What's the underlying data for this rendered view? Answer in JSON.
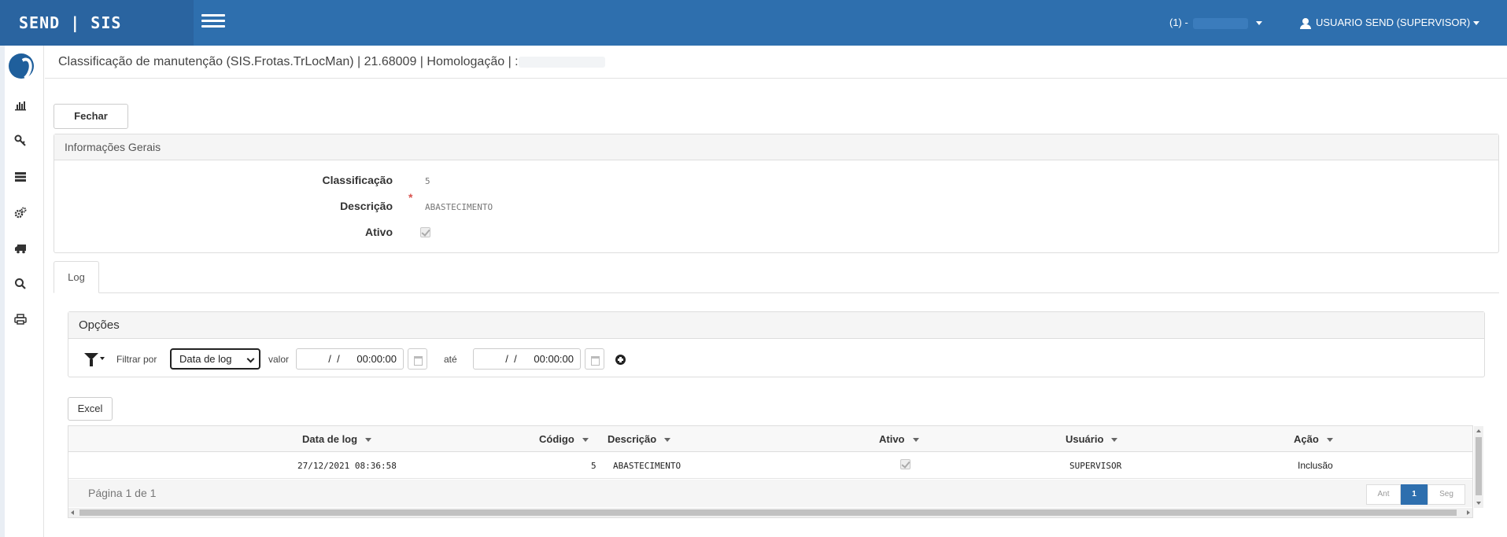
{
  "app": {
    "brand": "SEND | SIS",
    "company_prefix": "(1) -",
    "user": "USUARIO SEND (SUPERVISOR)"
  },
  "colors": {
    "topbar": "#2e6fae",
    "brand_bg": "#2a64a0",
    "accent": "#2e6fae",
    "required": "#d9534f"
  },
  "sidebar": {
    "icons": [
      "logo-icon",
      "bar-chart-icon",
      "key-icon",
      "list-icon",
      "gears-icon",
      "truck-icon",
      "search-icon",
      "print-icon"
    ]
  },
  "page": {
    "title": "Classificação de manutenção (SIS.Frotas.TrLocMan) | 21.68009 | Homologação | :"
  },
  "toolbar": {
    "close_label": "Fechar"
  },
  "general": {
    "heading": "Informações Gerais",
    "fields": {
      "classification_label": "Classificação",
      "classification_value": "5",
      "description_label": "Descrição",
      "description_value": "ABASTECIMENTO",
      "active_label": "Ativo",
      "required_mark": "*"
    }
  },
  "tabs": [
    {
      "label": "Log"
    }
  ],
  "options": {
    "heading": "Opções",
    "filter_by_label": "Filtrar por",
    "filter_select_value": "Data de log",
    "value_label": "valor",
    "date_from": "  /  /      00:00:00",
    "until_label": "até",
    "date_to": "  /  /      00:00:00"
  },
  "excel_label": "Excel",
  "grid": {
    "columns": [
      "Data de log",
      "Código",
      "Descrição",
      "Ativo",
      "Usuário",
      "Ação"
    ],
    "rows": [
      {
        "data_log": "27/12/2021 08:36:58",
        "codigo": "5",
        "descricao": "ABASTECIMENTO",
        "ativo": true,
        "usuario": "SUPERVISOR",
        "acao": "Inclusão"
      }
    ],
    "page_info": "Página 1 de 1",
    "pager": {
      "prev": "Ant",
      "current": "1",
      "next": "Seg"
    }
  }
}
